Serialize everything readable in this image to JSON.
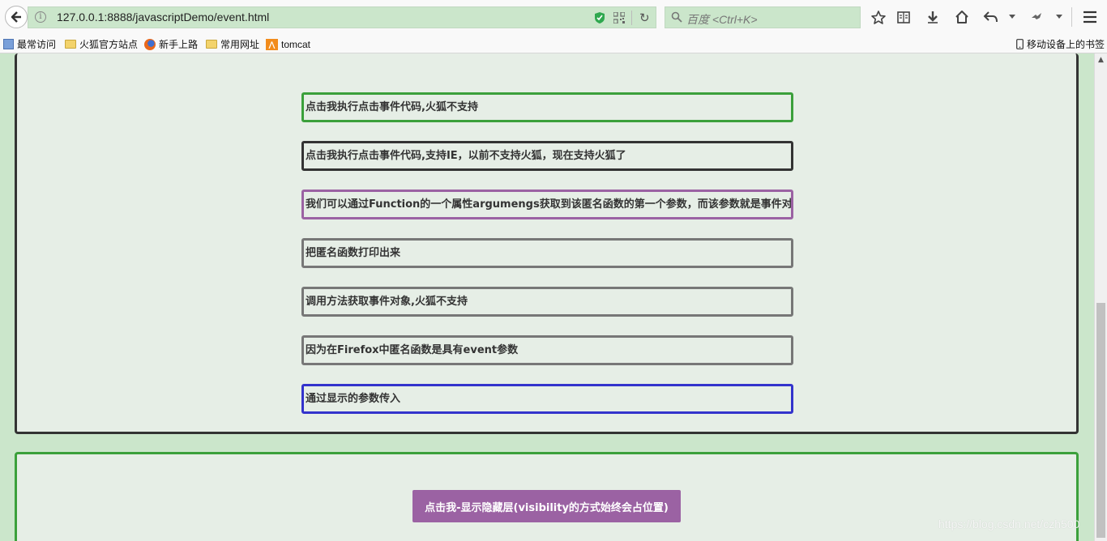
{
  "browser": {
    "url": "127.0.0.1:8888/javascriptDemo/event.html",
    "search_placeholder": "百度 <Ctrl+K>"
  },
  "bookmarks": [
    {
      "label": "最常访问",
      "icon": "bookmark-icon"
    },
    {
      "label": "火狐官方站点",
      "icon": "folder-icon"
    },
    {
      "label": "新手上路",
      "icon": "firefox-icon"
    },
    {
      "label": "常用网址",
      "icon": "folder-icon"
    },
    {
      "label": "tomcat",
      "icon": "tomcat-icon"
    }
  ],
  "mobile_bookmarks": "移动设备上的书签",
  "items": [
    {
      "text": "点击我执行点击事件代码,火狐不支持",
      "border": "#3ba03b"
    },
    {
      "text": "点击我执行点击事件代码,支持IE，以前不支持火狐，现在支持火狐了",
      "border": "#333333"
    },
    {
      "text": "我们可以通过Function的一个属性argumengs获取到该匿名函数的第一个参数，而该参数就是事件对象",
      "border": "#9b62a3"
    },
    {
      "text": "把匿名函数打印出来",
      "border": "#777777"
    },
    {
      "text": "调用方法获取事件对象,火狐不支持",
      "border": "#777777"
    },
    {
      "text": "因为在Firefox中匿名函数是具有event参数",
      "border": "#777777"
    },
    {
      "text": "通过显示的参数传入",
      "border": "#3333cc"
    }
  ],
  "show_button": "点击我-显示隐藏层(visibility的方式始终会占位置)",
  "watermark": "https://blog.csdn.net/czh500"
}
